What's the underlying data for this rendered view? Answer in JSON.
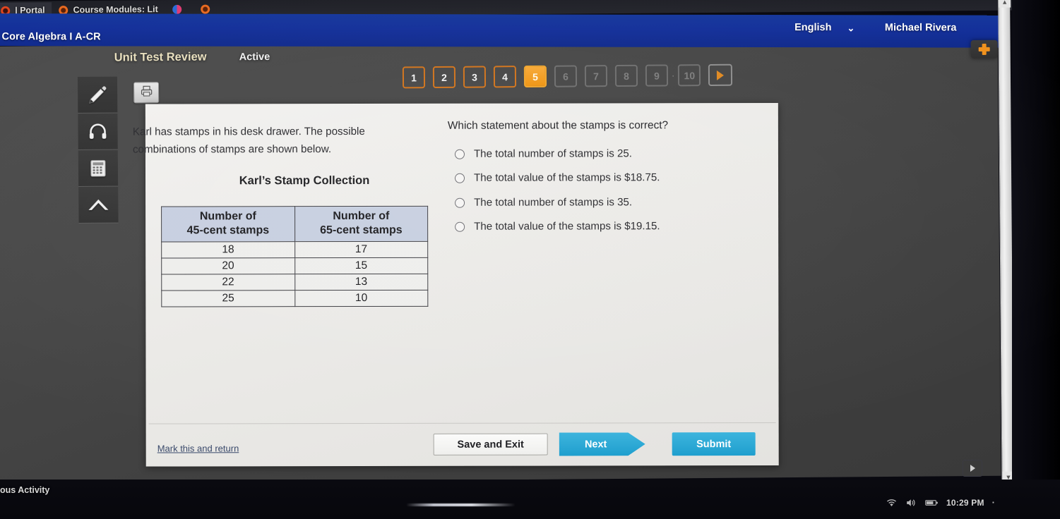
{
  "browser": {
    "tabs": [
      {
        "label": "| Portal",
        "favicon": "red-circle-icon"
      },
      {
        "label": "Course Modules: Lit",
        "favicon": "orange-ring-icon"
      },
      {
        "label": "",
        "favicon": "blue-pink-icon"
      },
      {
        "label": "",
        "favicon": "orange-circle-icon"
      }
    ]
  },
  "appbar": {
    "course_title": "n Core Algebra I A-CR",
    "language": "English",
    "language_caret": "⌄",
    "username": "Michael Rivera",
    "bg_color": "#14309a"
  },
  "activity": {
    "title": "Unit Test Review",
    "status": "Active",
    "title_color": "#e8dfbe"
  },
  "tools": [
    {
      "name": "highlighter-tool",
      "icon": "pencil-icon"
    },
    {
      "name": "text-to-speech-tool",
      "icon": "headphones-icon"
    },
    {
      "name": "calculator-tool",
      "icon": "calculator-icon"
    },
    {
      "name": "resources-tool",
      "icon": "caret-up-icon"
    }
  ],
  "print_button": {
    "icon": "printer-icon"
  },
  "add_button": {
    "icon": "plus-icon",
    "color": "#f0921e"
  },
  "pager": {
    "items": [
      {
        "label": "1",
        "state": "done"
      },
      {
        "label": "2",
        "state": "done"
      },
      {
        "label": "3",
        "state": "done"
      },
      {
        "label": "4",
        "state": "done"
      },
      {
        "label": "5",
        "state": "current"
      },
      {
        "label": "6",
        "state": "todo"
      },
      {
        "label": "7",
        "state": "todo"
      },
      {
        "label": "8",
        "state": "todo"
      },
      {
        "label": "9",
        "state": "todo"
      },
      {
        "label": "10",
        "state": "todo"
      }
    ],
    "next_icon": "play-triangle-icon",
    "current_color": "#ef9412",
    "done_border_color": "#d2741c"
  },
  "question": {
    "stem": "Karl has stamps in his desk drawer. The possible combinations of stamps are shown below.",
    "table_caption": "Karl’s Stamp Collection",
    "prompt": "Which statement about the stamps is correct?",
    "table": {
      "headers": [
        "Number of\n45-cent stamps",
        "Number of\n65-cent stamps"
      ],
      "header_line1": [
        "Number of",
        "Number of"
      ],
      "header_line2": [
        "45-cent stamps",
        "65-cent stamps"
      ],
      "rows": [
        [
          "18",
          "17"
        ],
        [
          "20",
          "15"
        ],
        [
          "22",
          "13"
        ],
        [
          "25",
          "10"
        ]
      ]
    },
    "choices": [
      {
        "label": "The total number of stamps is 25.",
        "selected": false
      },
      {
        "label": "The total value of the stamps is $18.75.",
        "selected": false
      },
      {
        "label": "The total number of stamps is 35.",
        "selected": false
      },
      {
        "label": "The total value of the stamps is $19.15.",
        "selected": false
      }
    ]
  },
  "footer": {
    "mark_link": "Mark this and return",
    "save_and_exit": "Save and Exit",
    "next": "Next",
    "submit": "Submit",
    "accent_color": "#1f9fce"
  },
  "taskbar": {
    "previous_activity": "ous Activity",
    "clock": "10:29 PM",
    "tray_icons": [
      "wifi-icon",
      "volume-icon",
      "battery-icon"
    ],
    "notification_dot": "·"
  }
}
